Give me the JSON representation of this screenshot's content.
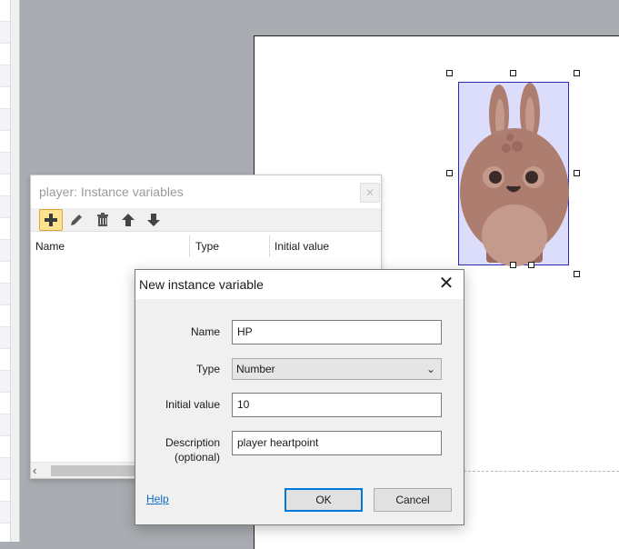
{
  "panel": {
    "title": "player: Instance variables",
    "toolbar": [
      "add-icon",
      "edit-icon",
      "delete-icon",
      "move-up-icon",
      "move-down-icon"
    ],
    "columns": [
      "Name",
      "Type",
      "Initial value"
    ]
  },
  "dialog": {
    "title": "New instance variable",
    "fields": {
      "name_label": "Name",
      "name_value": "HP",
      "type_label": "Type",
      "type_value": "Number",
      "initial_label": "Initial value",
      "initial_value": "10",
      "desc_label_1": "Description",
      "desc_label_2": "(optional)",
      "desc_value": "player heartpoint"
    },
    "help": "Help",
    "ok": "OK",
    "cancel": "Cancel"
  },
  "colors": {
    "accent": "#0078d7",
    "toolbar_active": "#fbe38f",
    "selection": "#2b2bb5",
    "sprite": "#ad7d6f"
  }
}
